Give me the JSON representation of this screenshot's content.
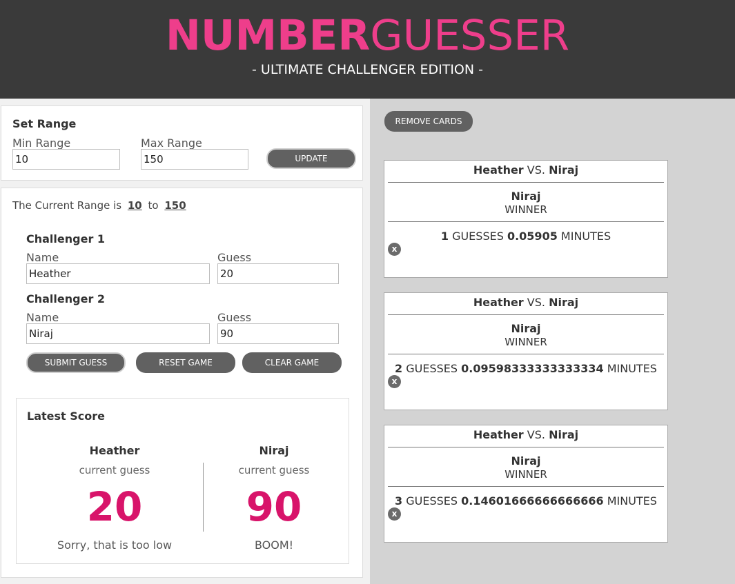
{
  "header": {
    "title_bold": "NUMBER",
    "title_light": "GUESSER",
    "subtitle": "-  ULTIMATE CHALLENGER EDITION -"
  },
  "range": {
    "heading": "Set Range",
    "min_label": "Min Range",
    "min_value": "10",
    "max_label": "Max Range",
    "max_value": "150",
    "update_label": "UPDATE"
  },
  "current_range": {
    "prefix": "The Current Range is",
    "min": "10",
    "to": "to",
    "max": "150"
  },
  "challenger1": {
    "heading": "Challenger 1",
    "name_label": "Name",
    "name_value": "Heather",
    "guess_label": "Guess",
    "guess_value": "20"
  },
  "challenger2": {
    "heading": "Challenger 2",
    "name_label": "Name",
    "name_value": "Niraj",
    "guess_label": "Guess",
    "guess_value": "90"
  },
  "buttons": {
    "submit": "SUBMIT GUESS",
    "reset": "RESET GAME",
    "clear": "CLEAR GAME",
    "remove_cards": "REMOVE CARDS"
  },
  "latest_score": {
    "heading": "Latest Score",
    "left": {
      "name": "Heather",
      "sub": "current guess",
      "value": "20",
      "message": "Sorry, that is too low"
    },
    "right": {
      "name": "Niraj",
      "sub": "current guess",
      "value": "90",
      "message": "BOOM!"
    }
  },
  "cards": [
    {
      "p1": "Heather",
      "vs": "VS.",
      "p2": "Niraj",
      "winner": "Niraj",
      "winner_label": "WINNER",
      "guesses": "1",
      "guesses_label": "GUESSES",
      "minutes": "0.05905",
      "minutes_label": "MINUTES",
      "close": "x"
    },
    {
      "p1": "Heather",
      "vs": "VS.",
      "p2": "Niraj",
      "winner": "Niraj",
      "winner_label": "WINNER",
      "guesses": "2",
      "guesses_label": "GUESSES",
      "minutes": "0.09598333333333334",
      "minutes_label": "MINUTES",
      "close": "x"
    },
    {
      "p1": "Heather",
      "vs": "VS.",
      "p2": "Niraj",
      "winner": "Niraj",
      "winner_label": "WINNER",
      "guesses": "3",
      "guesses_label": "GUESSES",
      "minutes": "0.14601666666666666",
      "minutes_label": "MINUTES",
      "close": "x"
    }
  ],
  "colors": {
    "brand_pink": "#ee3e8b",
    "score_pink": "#d8146a",
    "header_bg": "#3a3a3a",
    "button_bg": "#616161"
  }
}
